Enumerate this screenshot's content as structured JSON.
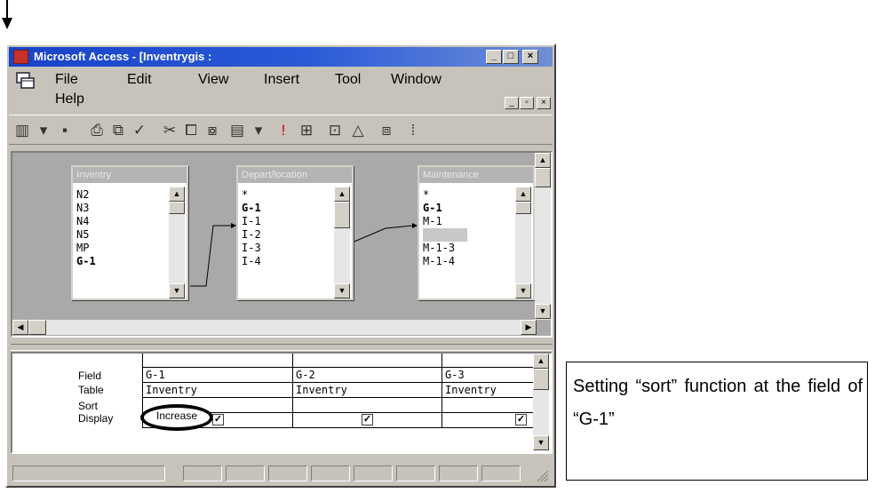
{
  "window": {
    "title": "Microsoft Access - [Inventrygis :",
    "title_buttons": [
      "_",
      "□",
      "×"
    ]
  },
  "menubar": {
    "items": [
      "File",
      "Edit",
      "View",
      "Insert",
      "Tool",
      "Window",
      "Help"
    ],
    "mdi_buttons": [
      "_",
      "▫",
      "×"
    ]
  },
  "toolbar": {
    "icons": [
      "view-icon",
      "dropdown-icon",
      "save-icon",
      "print-icon",
      "print-preview-icon",
      "spelling-icon",
      "cut-icon",
      "copy-icon",
      "paste-icon",
      "query-type-icon",
      "dropdown-icon",
      "run-icon",
      "show-table-icon",
      "properties-icon",
      "build-icon",
      "database-window-icon",
      "more-icon"
    ],
    "glyphs": [
      "▥",
      "▾",
      "▪",
      "⎙",
      "⧉",
      "✓",
      "✂",
      "⧠",
      "⧇",
      "▤",
      "▾",
      "!",
      "⊞",
      "⊡",
      "△",
      "⧈",
      "⁞"
    ]
  },
  "tables": [
    {
      "name": "Inventry",
      "fields": [
        "N2",
        "N3",
        "N4",
        "N5",
        "MP",
        "G-1"
      ],
      "bold": [
        5
      ]
    },
    {
      "name": "Depart/location",
      "fields": [
        "*",
        "G-1",
        "I-1",
        "I-2",
        "I-3",
        "I-4"
      ],
      "bold": [
        1
      ]
    },
    {
      "name": "Maintenance",
      "fields": [
        "*",
        "G-1",
        "M-1",
        "",
        "M-1-3",
        "M-1-4"
      ],
      "bold": [
        1
      ]
    }
  ],
  "grid": {
    "row_labels": [
      "Field",
      "Table",
      "Sort",
      "Display"
    ],
    "columns": [
      {
        "field": "G-1",
        "table": "Inventry",
        "sort": "Increase",
        "display": true
      },
      {
        "field": "G-2",
        "table": "Inventry",
        "sort": "",
        "display": true
      },
      {
        "field": "G-3",
        "table": "Inventry",
        "sort": "",
        "display": true
      }
    ]
  },
  "caption": {
    "text": "Setting “sort” function at the field of “G-1”"
  },
  "colors": {
    "titlebar": "#1843c8",
    "window_face": "#c7c3bb",
    "design_area": "#a9a9a9"
  }
}
